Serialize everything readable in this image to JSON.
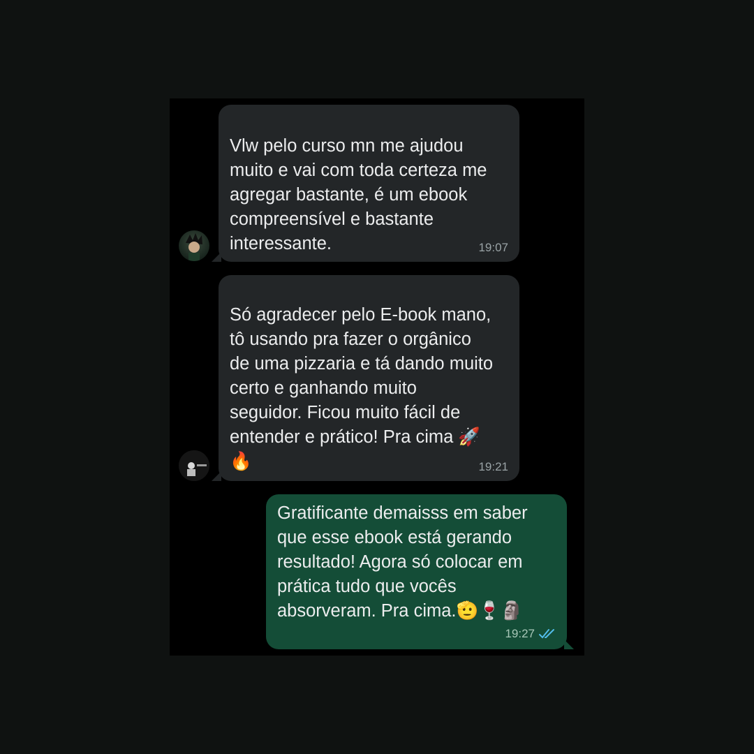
{
  "messages": [
    {
      "direction": "incoming",
      "text_lines": [
        "Vlw pelo curso mn me ajudou",
        "muito e vai com toda certeza me",
        "agregar bastante, é um ebook",
        "compreensível e bastante",
        "interessante."
      ],
      "time": "19:07",
      "avatar_icon": "profile-avatar-icon"
    },
    {
      "direction": "incoming",
      "text_lines": [
        "Só agradecer pelo E-book mano,",
        "tô usando pra fazer o orgânico",
        "de uma pizzaria e tá dando muito",
        "certo e ganhando muito",
        "seguidor. Ficou muito fácil de",
        "entender e prático! Pra cima 🚀",
        "🔥"
      ],
      "time": "19:21",
      "avatar_icon": "profile-avatar-icon"
    },
    {
      "direction": "outgoing",
      "text_lines": [
        "Gratificante demaisss em saber",
        "que esse ebook está gerando",
        "resultado! Agora só colocar em",
        "prática tudo que vocês",
        "absorveram. Pra cima.🫡🍷🗿"
      ],
      "time": "19:27",
      "status_icon": "double-check-read-icon"
    }
  ],
  "colors": {
    "incoming_bubble": "#232628",
    "outgoing_bubble": "#144d37",
    "read_ticks": "#53bdeb"
  }
}
